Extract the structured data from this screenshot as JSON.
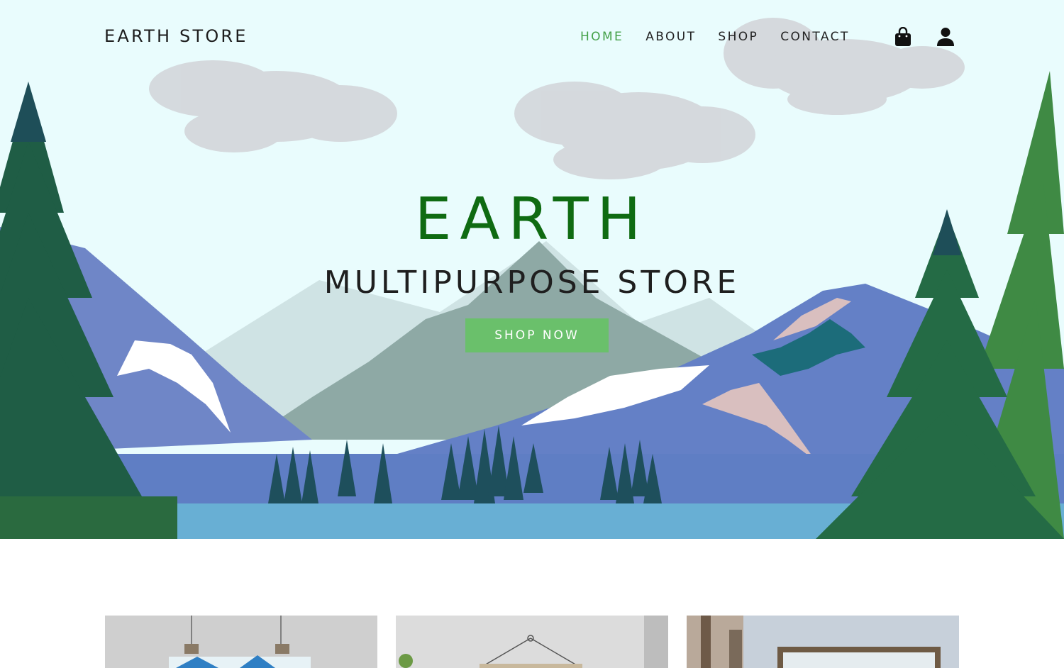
{
  "site": {
    "logo": "EARTH STORE"
  },
  "nav": {
    "items": [
      {
        "label": "HOME",
        "active": true
      },
      {
        "label": "ABOUT",
        "active": false
      },
      {
        "label": "SHOP",
        "active": false
      },
      {
        "label": "CONTACT",
        "active": false
      }
    ],
    "icons": [
      "shopping-bag-icon",
      "user-icon"
    ]
  },
  "hero": {
    "title": "EARTH",
    "subtitle": "MULTIPURPOSE STORE",
    "cta_label": "SHOP NOW"
  },
  "colors": {
    "accent": "#43a047",
    "title_green": "#0f6b12",
    "button_green": "#6ac06b",
    "sky": "#e9fcfd"
  }
}
